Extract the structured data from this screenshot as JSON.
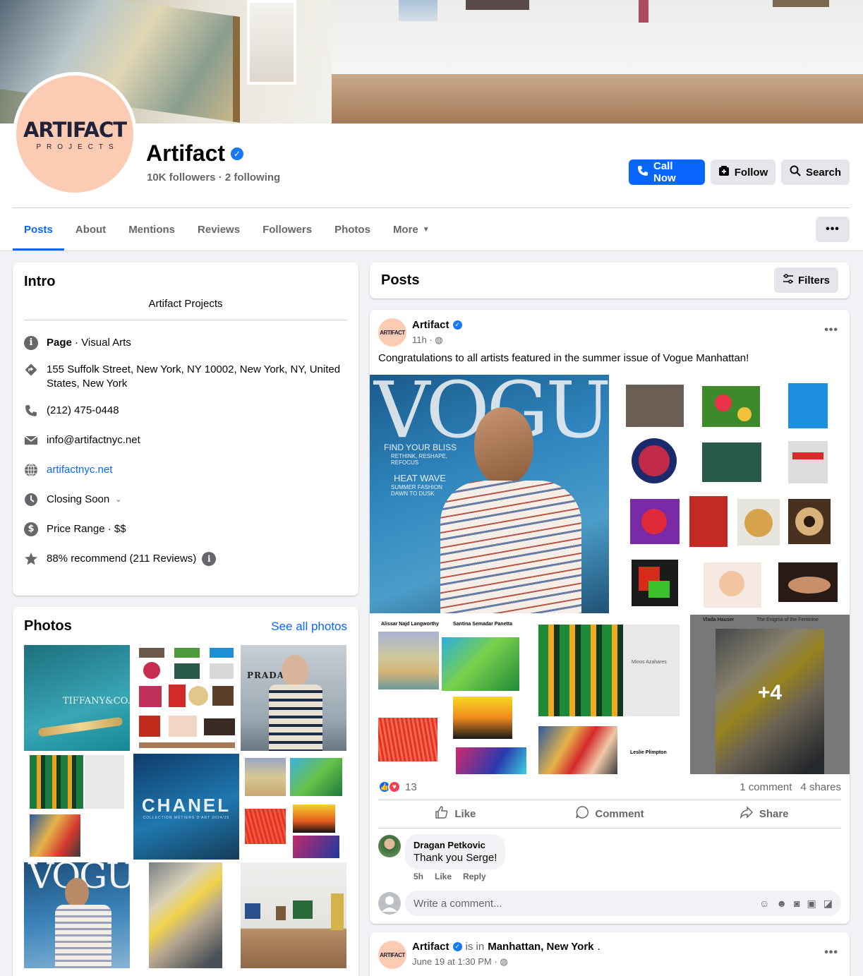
{
  "page": {
    "name": "Artifact",
    "logo_main": "ARTIFACT",
    "logo_sub": "PROJECTS",
    "followers": "10K followers",
    "following": "2 following",
    "separator": " · "
  },
  "buttons": {
    "call": "Call Now",
    "follow": "Follow",
    "search": "Search"
  },
  "tabs": [
    {
      "label": "Posts",
      "active": true
    },
    {
      "label": "About"
    },
    {
      "label": "Mentions"
    },
    {
      "label": "Reviews"
    },
    {
      "label": "Followers"
    },
    {
      "label": "Photos"
    },
    {
      "label": "More"
    }
  ],
  "intro": {
    "title": "Intro",
    "bio": "Artifact Projects",
    "page_type_bold": "Page",
    "page_type_rest": " · Visual Arts",
    "address": "155 Suffolk Street, New York, NY 10002, New York, NY, United States, New York",
    "phone": "(212) 475-0448",
    "email": "info@artifactnyc.net",
    "website": "artifactnyc.net",
    "hours": "Closing Soon",
    "price": "Price Range · $$",
    "rating": "88% recommend (211 Reviews)"
  },
  "photos": {
    "title": "Photos",
    "see_all": "See all photos",
    "thumb_texts": {
      "tiffany": "TIFFANY&CO.",
      "prada": "PRADA",
      "chanel": "CHANEL",
      "chanel_sub": "COLLECTION MÉTIERS D'ART 2024/25",
      "vogue": "VOGUE"
    }
  },
  "posts": {
    "title": "Posts",
    "filters": "Filters"
  },
  "post1": {
    "author": "Artifact",
    "time": "11h",
    "text": "Congratulations to all artists featured in the summer issue of Vogue Manhattan!",
    "vogue": {
      "mast": "VOGUE",
      "l1": "FIND YOUR BLISS",
      "l2": "RETHINK, RESHAPE, REFOCUS",
      "l3": "HEAT WAVE",
      "l4": "SUMMER FASHION DAWN TO DUSK"
    },
    "more_count": "+4",
    "artist_a": "Alissar Najd Langworthy",
    "artist_b": "Santina Semadar Panetta",
    "artist_c": "Minos Azahares",
    "artist_d": "Leslie Plimpton",
    "artist_e": "Vlada Hauser",
    "artist_e_title": "The Enigma of the Feminine",
    "reactions": "13",
    "comments": "1 comment",
    "shares": "4 shares",
    "like": "Like",
    "comment": "Comment",
    "share": "Share",
    "c_author": "Dragan Petkovic",
    "c_text": "Thank you Serge!",
    "c_time": "5h",
    "c_like": "Like",
    "c_reply": "Reply",
    "write_placeholder": "Write a comment..."
  },
  "post2": {
    "author": "Artifact",
    "is_in": "is in",
    "location": "Manhattan, New York",
    "time": "June 19 at 1:30 PM"
  },
  "colors": {
    "accent": "#0866ff",
    "avatar_bg": "#fbcbb3",
    "logo_navy": "#1f2238",
    "love": "#f33e58"
  }
}
